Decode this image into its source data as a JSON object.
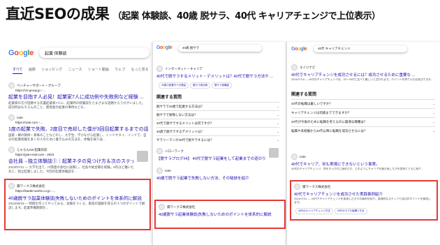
{
  "headline": {
    "main": "直近SEOの成果",
    "sub": "（起業 体験談、40歳 脱サラ、40代 キャリアチェンジで上位表示）"
  },
  "panel1": {
    "logo": [
      "G",
      "o",
      "o",
      "g",
      "l",
      "e"
    ],
    "query": "起業 体験談",
    "tabs": [
      "すべて",
      "画像",
      "ショッピング",
      "ニュース",
      "ショート動画",
      "ウェブ",
      "もっと見る"
    ],
    "results": [
      {
        "site": "ベンチャーサポート・グループ",
        "url": "https://vs-group.jp › ...",
        "title": "起業を目指す人必見！起業家7人に成功例や失敗例など経験 ...",
        "snip": "起業家の方が話題する先輩起業家7人に、起業時の経験談をさまざまな話題からうかがいました。成功例はもちろんのこと、無借金の起業の事例なども..."
      },
      {
        "site": "note",
        "url": "https://note.com › ...",
        "title": "1度の起業で失敗、2度目で売却した僕が3回目起業するまでの話",
        "snip": "国家・郷の教師・将来のことなどのし、大学生、学びながら起業し、インドやタイ、インドで、自分の起業経験を多くの人のために書き込みの方法を、体験を振り返..."
      },
      {
        "site": "じゃらんnet 起業日誌",
        "url": "https://jyan-eval.com › 2023",
        "title": "会社員→独立体験談①｜起業ネタの見つけ方＆次のステップ",
        "snip": "2023/07/21 — 大学を出て、IT関連の会社に就職し、社長や総合職を経験。8年ほど働いたあと、独立起業しました。今回の起業体験談を..."
      },
      {
        "site": "陽ワークス株式会社",
        "url": "https://kaede-works.co.jp › ...",
        "title": "40歳脱サラ起業体験談|失敗しないためのポイントを体系的に解説",
        "snip": "2024/06/19 — 時間を作ってやってみる、実績をつくる、家族の理解を得るの３つのポイントで解説します。起業準備期間を..."
      }
    ]
  },
  "panel2": {
    "logo": [
      "G",
      "o",
      "o",
      "g",
      "l",
      "e"
    ],
    "query": "40歳 脱サラ",
    "results": [
      {
        "site": "インターネット・キャリア",
        "url": "https://...",
        "title": "40代で脱サラするメリット・デメリットは？40代で脱サラ方法や ...",
        "snip": ""
      },
      {
        "site": "ハローワーク",
        "url": "https://...",
        "title": "【脱サラブログ#4】 40代で脱サラ起業をして起業までの道のり ...",
        "snip": ""
      },
      {
        "site": "note",
        "url": "https://...",
        "title": "40歳で脱サラ起業で失敗しない方法、その秘訣を紹介",
        "snip": ""
      },
      {
        "site": "陽ワークス株式会社",
        "url": "https://...",
        "title": "40歳脱サラ起業体験談|失敗しないためのポイントを体系的に解説",
        "snip": ""
      }
    ],
    "paa": {
      "heading": "関連する質問",
      "questions": [
        "脱サラで40歳で起業する方法は？",
        "脱サラで後悔しない方法は？",
        "40代で脱サラするメリットは何ですか？",
        "40歳で脱サラするデメリットは？",
        "サラリーマンが40代で脱サラするには？"
      ]
    },
    "chips": [
      "40歳で起業すべき理由",
      "脱サラ成功例",
      "脱サラ体験談"
    ]
  },
  "panel3": {
    "logo": [
      "G",
      "o",
      "o",
      "g",
      "l",
      "e"
    ],
    "query": "40代 キャリアチェンジ",
    "top": {
      "site": "エイジナビ",
      "title": "40代でキャリアチェンジを成功させるには？成功させるために重要な ...",
      "snip": "2024/07/15 — 40代のキャリアチェンジは、20〜30代と比べて難しいと言われます。ポイントを押さえれば成功できる..."
    },
    "paa": {
      "heading": "関連する質問",
      "questions": [
        "40代の転職は厳しいですか？",
        "キャリアチェンジは何歳までできますか？",
        "40代が今後のために転職を考えるのに最適な職種は？",
        "転職や未経験から40代以降に転職を成功させるには？"
      ]
    },
    "results": [
      {
        "site": "note",
        "url": "https://...",
        "title": "40代でキャリア、何も実現にできないという事実。",
        "snip": "40代のキャリアチェンジ、何をきっかけに始めたか、どのようにキャリアを築き直したかを実例とともに紹介..."
      },
      {
        "site": "陽ワークス株式会社",
        "url": "https://...",
        "title": "40代でキャリアチェンジを成功させた実践事例紹介",
        "snip": "2024/07/11 — 40代でキャリアチェンジを実現した方々の事例を紹介。実践的なステップと成功のポイントを解説します。"
      }
    ],
    "chips": [
      "40代のキャリアチェンジ方法",
      "40代からでも転職できる"
    ]
  }
}
